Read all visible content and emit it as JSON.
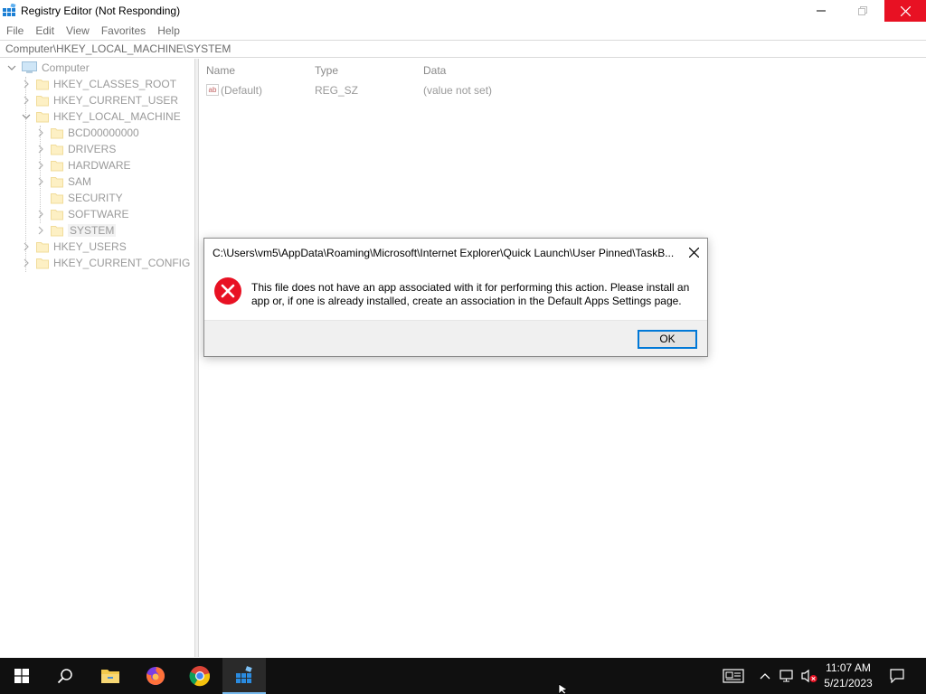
{
  "window": {
    "title": "Registry Editor (Not Responding)",
    "icons": {
      "app": "regedit-icon",
      "minimize": "minimize-icon",
      "maximize": "maximize-icon",
      "close": "close-icon"
    }
  },
  "menu": [
    "File",
    "Edit",
    "View",
    "Favorites",
    "Help"
  ],
  "address": "Computer\\HKEY_LOCAL_MACHINE\\SYSTEM",
  "tree": {
    "root": "Computer",
    "hives": {
      "classes_root": "HKEY_CLASSES_ROOT",
      "current_user": "HKEY_CURRENT_USER",
      "local_machine": "HKEY_LOCAL_MACHINE",
      "users": "HKEY_USERS",
      "current_config": "HKEY_CURRENT_CONFIG"
    },
    "local_machine_children": [
      "BCD00000000",
      "DRIVERS",
      "HARDWARE",
      "SAM",
      "SECURITY",
      "SOFTWARE",
      "SYSTEM"
    ],
    "selected": "SYSTEM"
  },
  "list": {
    "columns": {
      "name": "Name",
      "type": "Type",
      "data": "Data"
    },
    "rows": [
      {
        "name": "(Default)",
        "type": "REG_SZ",
        "data": "(value not set)"
      }
    ]
  },
  "dialog": {
    "title": "C:\\Users\\vm5\\AppData\\Roaming\\Microsoft\\Internet Explorer\\Quick Launch\\User Pinned\\TaskB...",
    "message": "This file does not have an app associated with it for performing this action. Please install an app or, if one is already installed, create an association in the Default Apps Settings page.",
    "ok_label": "OK",
    "icon": "error-icon"
  },
  "taskbar": {
    "apps": [
      "start-icon",
      "search-icon",
      "file-explorer-icon",
      "firefox-icon",
      "chrome-icon",
      "regedit-icon"
    ],
    "active_app": "regedit-icon",
    "tray": [
      "news-icon",
      "chevron-up-icon",
      "network-icon",
      "volume-muted-icon",
      "notification-icon"
    ],
    "time": "11:07 AM",
    "date": "5/21/2023"
  },
  "colors": {
    "close_button": "#e81123",
    "taskbar": "#101010",
    "accent": "#0078d7",
    "error_red": "#e81123"
  }
}
